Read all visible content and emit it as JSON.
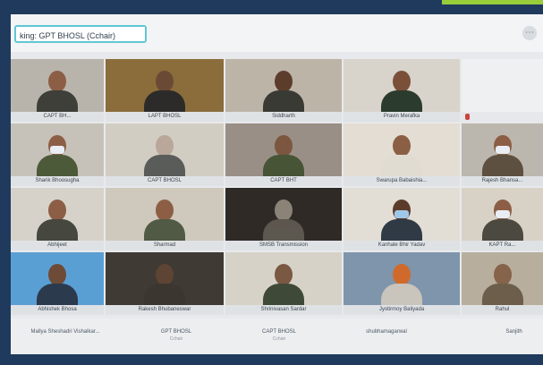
{
  "header": {
    "speaking_label": "king: GPT BHOSL (Cchair)",
    "more_label": "⋯"
  },
  "tiles": [
    {
      "label": "CAPT BH..."
    },
    {
      "label": "LAPT BHOSL"
    },
    {
      "label": "Siddharth"
    },
    {
      "label": "Pravin Merafka"
    },
    {
      "label": "Sharik Bhoosugha"
    },
    {
      "label": "CAPT BHOSL"
    },
    {
      "label": "CAPT BHT"
    },
    {
      "label": "Swarupa Babaishia..."
    },
    {
      "label": "Rajesh Bhansa..."
    },
    {
      "label": "Abhijeet"
    },
    {
      "label": "Sharmad"
    },
    {
      "label": "SMSB Transmission"
    },
    {
      "label": "Kanhale Bhir Yadav"
    },
    {
      "label": "KAPT Ra..."
    },
    {
      "label": "Abhishek Bhosa"
    },
    {
      "label": "Rakesh Bhubaneswar"
    },
    {
      "label": "Shrinivasan Sardar"
    },
    {
      "label": "Jyotirmoy Baliyada"
    },
    {
      "label": "Rahul"
    }
  ],
  "bottom_bar": {
    "names": [
      {
        "name": "Mallya Sheshadri Vishalkar..."
      },
      {
        "name": "GPT BHOSL",
        "sub": "Cchair"
      },
      {
        "name": "CAPT BHOSL",
        "sub": "Cchair"
      },
      {
        "name": "shubhamagarwal"
      },
      {
        "name": "Sanjith"
      }
    ]
  }
}
